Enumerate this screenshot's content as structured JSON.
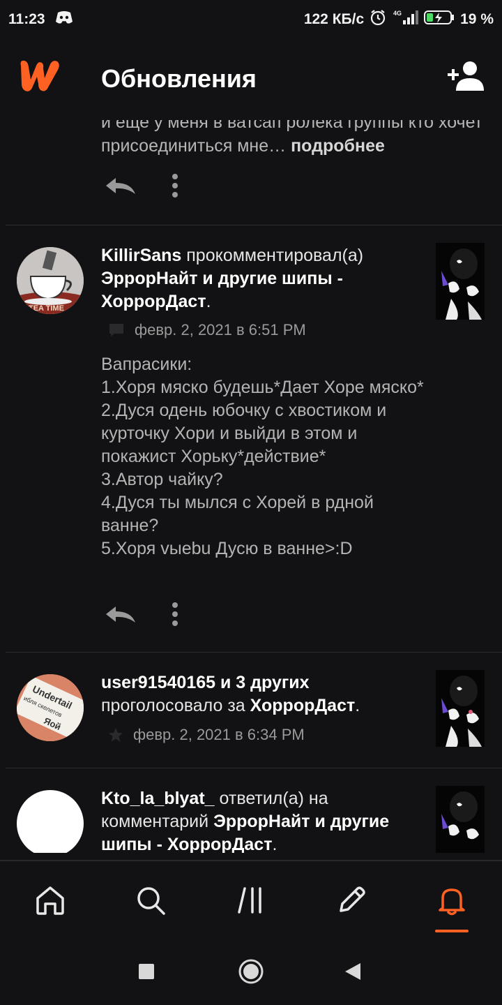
{
  "status_bar": {
    "time": "11:23",
    "network_speed": "122 КБ/с",
    "network_type": "4G",
    "battery": "19 %",
    "icons": [
      "discord-icon",
      "alarm-icon",
      "signal-icon",
      "battery-icon"
    ]
  },
  "app_bar": {
    "title": "Обновления",
    "logo": "wattpad-logo",
    "action_icon": "add-user-icon"
  },
  "feed": {
    "partial_item": {
      "text": "и еще у меня в ватсап ролека группы кто хочет присоединиться мне… ",
      "more_label": "подробнее"
    },
    "items": [
      {
        "user": "KillirSans",
        "action": " прокомментировал(а) ",
        "target": "ЭррорНайт и другие шипы - ХоррорДаст",
        "suffix": ".",
        "meta_icon": "comment-icon",
        "date": "февр. 2, 2021 в 6:51 PM",
        "comment": "Вапрасики:\n1.Хоря мяско будешь*Дает Хоре мяско*\n2.Дуся одень юбочку с хвостиком и курточку Хори и выйди в этом и покажист Хорьку*действие*\n3.Автор чайку?\n4.Дуся ты мылся с Хорей в рдной ванне?\n5.Хоря vыebu Дусю в ванне>:D",
        "avatar_text": "TEA TIME"
      },
      {
        "user": "user91540165 и 3 других",
        "action": "проголосовало за ",
        "target": "ХоррорДаст",
        "suffix": ".",
        "meta_icon": "star-icon",
        "date": "февр. 2, 2021 в 6:34 PM",
        "avatar_text_1": "Undertail",
        "avatar_text_2": "ибля скелетов",
        "avatar_text_3": "Яой"
      },
      {
        "user": "Kto_la_blyat_",
        "action": " ответил(а) на комментарий ",
        "target": "ЭррорНайт и другие шипы - ХоррорДаст",
        "suffix": "."
      }
    ]
  },
  "tab_bar": {
    "tabs": [
      "home-icon",
      "search-icon",
      "library-icon",
      "write-icon",
      "notifications-icon"
    ],
    "active": "notifications-icon",
    "accent": "#ff6122"
  },
  "nav_bar": [
    "recents-icon",
    "home-circle-icon",
    "back-icon"
  ]
}
